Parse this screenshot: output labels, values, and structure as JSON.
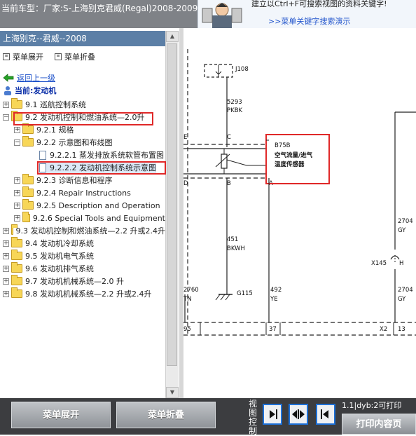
{
  "title_bar": {
    "title": "当前车型：厂家:S-上海别克君威(Regal)2008-2009",
    "ad_tip": "建立以Ctrl+F可搜索视图的资料关键字!",
    "ad_link": ">>菜单关键字搜索演示"
  },
  "left_panel": {
    "header": "上海别克--君威--2008",
    "menu_expand": "菜单展开",
    "menu_collapse": "菜单折叠",
    "back": "返回上一级",
    "current": "当前:发动机",
    "tree": [
      {
        "label": "9.1 巡航控制系统"
      },
      {
        "label": "9.2 发动机控制和燃油系统—2.0升"
      },
      {
        "label": "9.2.1 规格"
      },
      {
        "label": "9.2.2 示意图和布线图"
      },
      {
        "label": "9.2.2.1 蒸发排放系统软管布置图"
      },
      {
        "label": "9.2.2.2 发动机控制系统示意图"
      },
      {
        "label": "9.2.3 诊断信息和程序"
      },
      {
        "label": "9.2.4 Repair Instructions"
      },
      {
        "label": "9.2.5 Description and Operation"
      },
      {
        "label": "9.2.6 Special Tools and Equipment"
      },
      {
        "label": "9.3 发动机控制和燃油系统—2.2 升或2.4升"
      },
      {
        "label": "9.4 发动机冷却系统"
      },
      {
        "label": "9.5 发动机电气系统"
      },
      {
        "label": "9.6 发动机排气系统"
      },
      {
        "label": "9.7 发动机机械系统—2.0 升"
      },
      {
        "label": "9.8 发动机机械系统—2.2 升或2.4升"
      }
    ]
  },
  "diagram": {
    "connector_j108": "J108",
    "wire_5293": "5293",
    "wire_pkbk": "PKBK",
    "pin_c": "C",
    "pin_e": "E",
    "pin_b": "B",
    "pin_a": "A",
    "pin_d": "D",
    "sensor_id": "B75B",
    "sensor_name_1": "空气流量/进气",
    "sensor_name_2": "温度传感器",
    "wire_451": "451",
    "wire_bkwh": "BKWH",
    "ground_g115": "G115",
    "wire_2760": "2760",
    "wire_tn": "TN",
    "wire_492": "492",
    "wire_ye": "YE",
    "wire_2704_a": "2704",
    "wire_gy_a": "GY",
    "wire_2704_b": "2704",
    "wire_gy_b": "GY",
    "x145": "X145",
    "pin_h": "H",
    "pin_95": "95",
    "pin_37": "37",
    "x2": "X2",
    "pin_13": "13"
  },
  "bottom_bar": {
    "expand_button": "菜单展开",
    "collapse_button": "菜单折叠",
    "view_control": "视图控制",
    "status": "1.1|dyb:2可打印",
    "print_button": "打印内容页"
  }
}
